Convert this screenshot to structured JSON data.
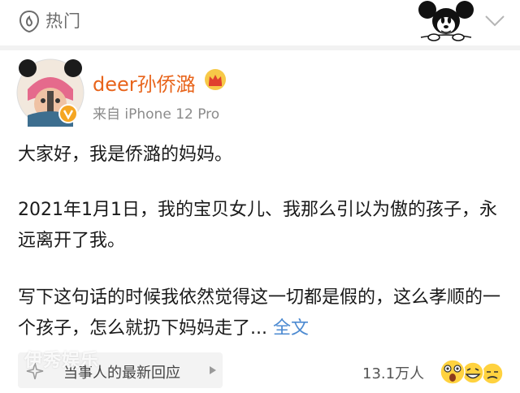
{
  "header": {
    "hot_label": "热门",
    "hot_icon": "hot-icon",
    "menu_icon": "chevron-down-icon",
    "decoration": "mickey-mouse-sticker"
  },
  "post": {
    "author": {
      "name": "deer孙侨潞",
      "source": "来自 iPhone 12 Pro",
      "badge": "crown-icon",
      "verified": "verified-icon"
    },
    "paragraphs": [
      "大家好，我是侨潞的妈妈。",
      "2021年1月1日，我的宝贝女儿、我那么引以为傲的孩子，永远离开了我。",
      "写下这句话的时候我依然觉得这一切都是假的，这么孝顺的一个孩子，怎么就扔下妈妈走了..."
    ],
    "full_text_link": "全文"
  },
  "footer": {
    "hot_reply_text": "当事人的最新回应",
    "watermark": "伊秀娱乐",
    "count": "13.1万人",
    "reactions": [
      "surprised-emoji",
      "laughing-emoji",
      "sad-emoji"
    ]
  },
  "colors": {
    "author_name": "#e8641b",
    "link": "#4c8ad1",
    "muted": "#8b8b8b"
  }
}
